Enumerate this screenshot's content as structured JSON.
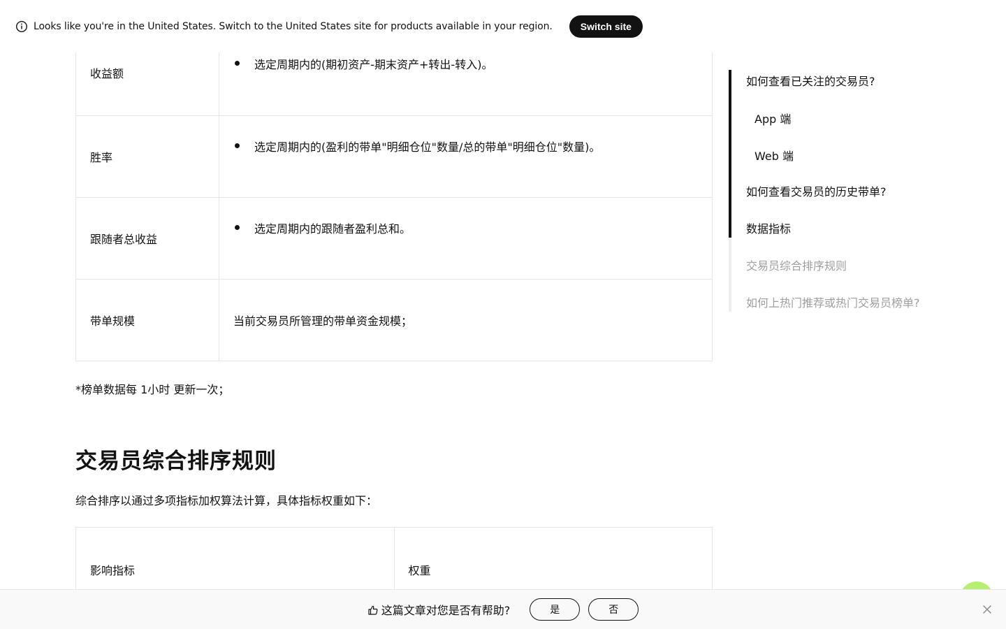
{
  "banner": {
    "text": "Looks like you're in the United States. Switch to the United States site for products available in your region.",
    "switch_label": "Switch site"
  },
  "metrics_table": {
    "rows": [
      {
        "label": "收益额",
        "desc": "选定周期内的(期初资产-期末资产+转出-转入)。",
        "bullet": true
      },
      {
        "label": "胜率",
        "desc": "选定周期内的(盈利的带单\"明细仓位\"数量/总的带单\"明细仓位\"数量)。",
        "bullet": true
      },
      {
        "label": "跟随者总收益",
        "desc": "选定周期内的跟随者盈利总和。",
        "bullet": true
      },
      {
        "label": "带单规模",
        "desc": "当前交易员所管理的带单资金规模；",
        "bullet": false
      }
    ]
  },
  "note": "*榜单数据每 1小时 更新一次；",
  "section": {
    "title": "交易员综合排序规则",
    "intro": "综合排序以通过多项指标加权算法计算，具体指标权重如下："
  },
  "weights_table": {
    "header": [
      "影响指标",
      "权重"
    ]
  },
  "toc": {
    "items": [
      {
        "label": "如何查看已关注的交易员?",
        "level": 1,
        "state": "active"
      },
      {
        "label": "App 端",
        "level": 2,
        "state": "active"
      },
      {
        "label": "Web 端",
        "level": 2,
        "state": "active"
      },
      {
        "label": "如何查看交易员的历史带单?",
        "level": 1,
        "state": "active"
      },
      {
        "label": "数据指标",
        "level": 1,
        "state": "active"
      },
      {
        "label": "交易员综合排序规则",
        "level": 1,
        "state": "inactive"
      },
      {
        "label": "如何上热门推荐或热门交易员榜单?",
        "level": 1,
        "state": "inactive"
      }
    ]
  },
  "feedback": {
    "question": "这篇文章对您是否有帮助?",
    "yes_label": "是",
    "no_label": "否"
  },
  "icons": {
    "info": "info-circle-icon",
    "thumb": "thumbs-up-icon",
    "close": "close-icon"
  },
  "colors": {
    "text": "#121212",
    "muted": "#9e9e9e",
    "border": "#e5e5e5",
    "accent": "#b7f06e",
    "button_dark": "#121212"
  }
}
